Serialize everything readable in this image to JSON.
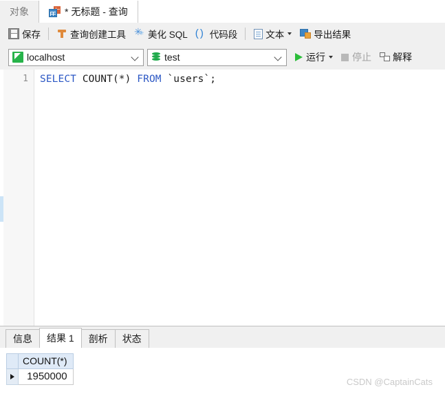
{
  "window": {
    "top_tabs": [
      {
        "label": "对象",
        "active": false,
        "icon": null
      },
      {
        "label": "* 无标题 - 查询",
        "active": true,
        "icon": "query-grid-icon"
      }
    ]
  },
  "toolbar": {
    "items": [
      {
        "label": "保存",
        "icon": "save-icon",
        "name": "save-button"
      },
      {
        "separator": true
      },
      {
        "label": "查询创建工具",
        "icon": "query-builder-icon",
        "name": "query-builder-button"
      },
      {
        "label": "美化 SQL",
        "icon": "beautify-wand-icon",
        "name": "beautify-sql-button"
      },
      {
        "label": "代码段",
        "icon": "code-snippet-icon",
        "name": "code-snippet-button"
      },
      {
        "separator": true
      },
      {
        "label": "文本",
        "icon": "text-document-icon",
        "name": "text-button",
        "has_dropdown": true
      },
      {
        "label": "导出结果",
        "icon": "export-result-icon",
        "name": "export-result-button"
      }
    ]
  },
  "connection_bar": {
    "host": {
      "value": "localhost",
      "icon": "mysql-connection-icon"
    },
    "database": {
      "value": "test",
      "icon": "database-icon"
    },
    "run": {
      "label": "运行",
      "icon": "play-icon",
      "has_dropdown": true,
      "disabled": false
    },
    "stop": {
      "label": "停止",
      "icon": "stop-icon",
      "disabled": true
    },
    "explain": {
      "label": "解释",
      "icon": "explain-icon",
      "disabled": false
    }
  },
  "editor": {
    "line_number": "1",
    "sql": {
      "kw_select": "SELECT",
      "mid": " COUNT(*) ",
      "kw_from": "FROM",
      "tail": " `users`;"
    }
  },
  "bottom_tabs": [
    {
      "label": "信息",
      "active": false
    },
    {
      "label": "结果 1",
      "active": true
    },
    {
      "label": "剖析",
      "active": false
    },
    {
      "label": "状态",
      "active": false
    }
  ],
  "result_grid": {
    "columns": [
      "COUNT(*)"
    ],
    "rows": [
      {
        "values": [
          "1950000"
        ]
      }
    ]
  },
  "watermark": "CSDN @CaptainCats",
  "colors": {
    "accent_blue": "#2b57c4",
    "run_green": "#2bbd3a",
    "header_blue": "#dfeaf7",
    "scroll_thumb": "#cce4f7"
  }
}
